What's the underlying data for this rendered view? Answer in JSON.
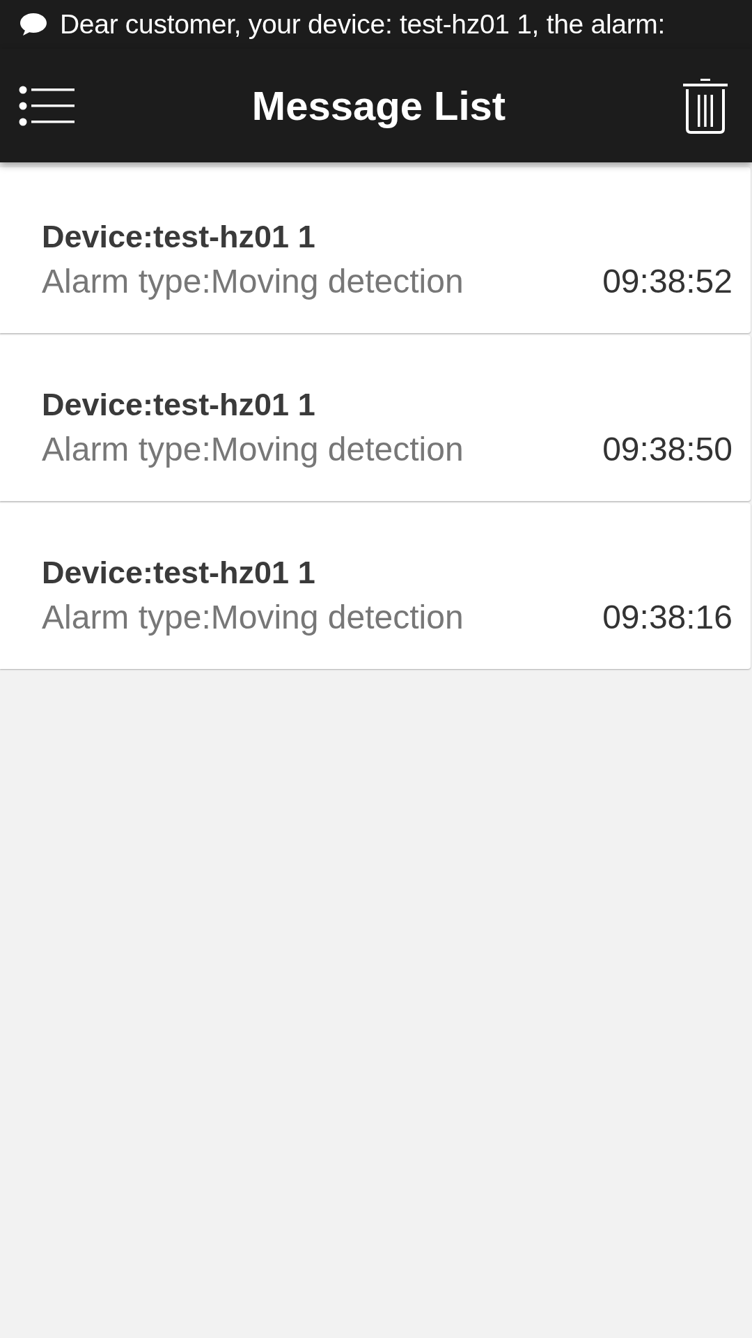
{
  "notification": {
    "text": "Dear customer, your device: test-hz01 1, the alarm:"
  },
  "header": {
    "title": "Message List"
  },
  "messages": [
    {
      "device": "Device:test-hz01 1",
      "alarm": "Alarm type:Moving detection",
      "time": "09:38:52"
    },
    {
      "device": "Device:test-hz01 1",
      "alarm": "Alarm type:Moving detection",
      "time": "09:38:50"
    },
    {
      "device": "Device:test-hz01 1",
      "alarm": "Alarm type:Moving detection",
      "time": "09:38:16"
    }
  ]
}
